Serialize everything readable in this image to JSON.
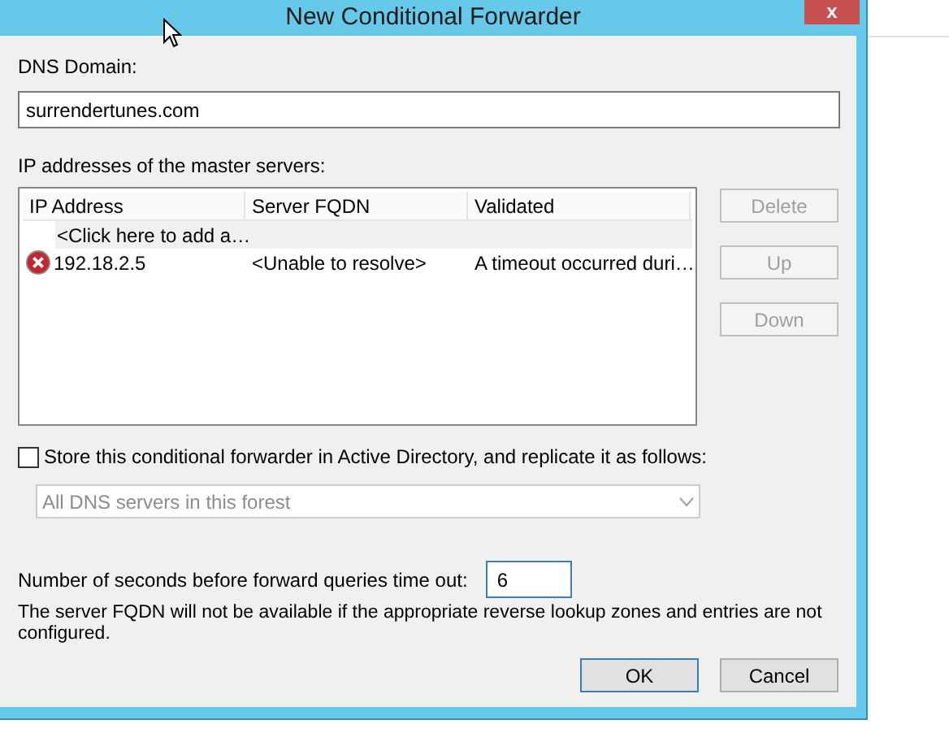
{
  "window": {
    "title": "New Conditional Forwarder",
    "close": "x"
  },
  "domain": {
    "label": "DNS Domain:",
    "value": "surrendertunes.com"
  },
  "servers": {
    "label": "IP addresses of the master servers:",
    "columns": [
      "IP Address",
      "Server FQDN",
      "Validated"
    ],
    "add_row": "<Click here to add a…",
    "rows": [
      {
        "error": true,
        "ip": "192.18.2.5",
        "fqdn": "<Unable to resolve>",
        "validated": "A timeout occurred duri…"
      }
    ]
  },
  "side_buttons": [
    {
      "label": "Delete",
      "disabled": true
    },
    {
      "label": "Up",
      "disabled": true
    },
    {
      "label": "Down",
      "disabled": true
    }
  ],
  "store": {
    "label": "Store this conditional forwarder in Active Directory, and replicate it as follows:",
    "checked": false
  },
  "replication": {
    "value": "All DNS servers in this forest",
    "disabled": true
  },
  "timeout": {
    "label": "Number of seconds before forward queries time out:",
    "value": "6"
  },
  "note": "The server FQDN will not be available if the appropriate reverse lookup zones and entries are not configured.",
  "buttons": [
    {
      "label": "OK",
      "default": true
    },
    {
      "label": "Cancel",
      "default": false
    }
  ]
}
